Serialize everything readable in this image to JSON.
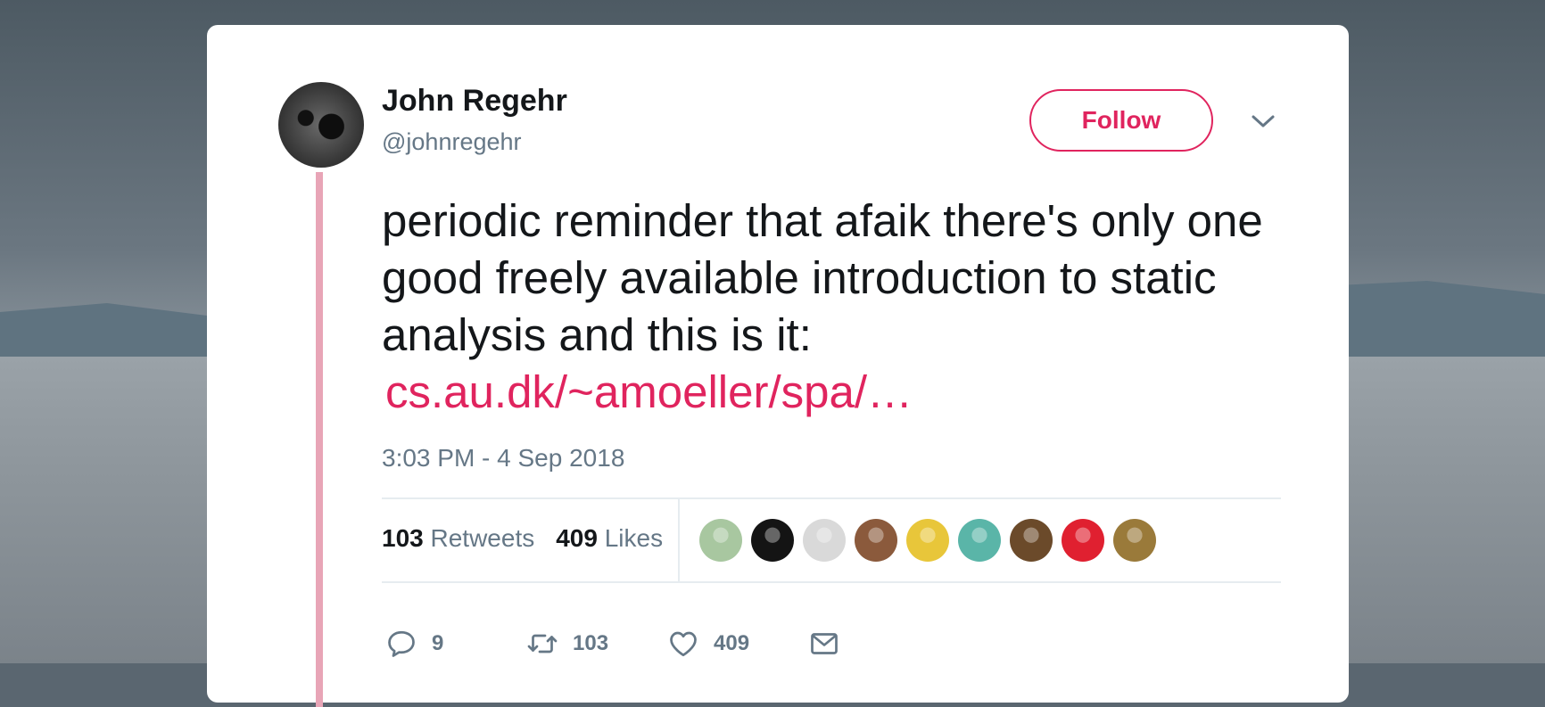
{
  "tweet": {
    "author_name": "John Regehr",
    "author_handle": "@johnregehr",
    "follow_label": "Follow",
    "text": "periodic reminder that afaik there's only one good freely available introduction to static analysis and this is it:",
    "link_text": "cs.au.dk/~amoeller/spa/…",
    "timestamp": "3:03 PM - 4 Sep 2018",
    "stats": {
      "retweets_count": "103",
      "retweets_label": "Retweets",
      "likes_count": "409",
      "likes_label": "Likes"
    },
    "liker_avatars": [
      {
        "name": "liker-avatar-1",
        "color": "#a8c7a0"
      },
      {
        "name": "liker-avatar-2",
        "color": "#141414"
      },
      {
        "name": "liker-avatar-3",
        "color": "#d9d9d9"
      },
      {
        "name": "liker-avatar-4",
        "color": "#8b5a3c"
      },
      {
        "name": "liker-avatar-5",
        "color": "#e8c63a"
      },
      {
        "name": "liker-avatar-6",
        "color": "#5ab5a8"
      },
      {
        "name": "liker-avatar-7",
        "color": "#6b4a2a"
      },
      {
        "name": "liker-avatar-8",
        "color": "#e02030"
      },
      {
        "name": "liker-avatar-9",
        "color": "#9a7a3a"
      }
    ],
    "actions": {
      "reply_count": "9",
      "retweet_count": "103",
      "like_count": "409"
    }
  },
  "colors": {
    "accent": "#e0245e",
    "thread_line": "#e8a5b7",
    "secondary_text": "#657786",
    "primary_text": "#14171a"
  }
}
